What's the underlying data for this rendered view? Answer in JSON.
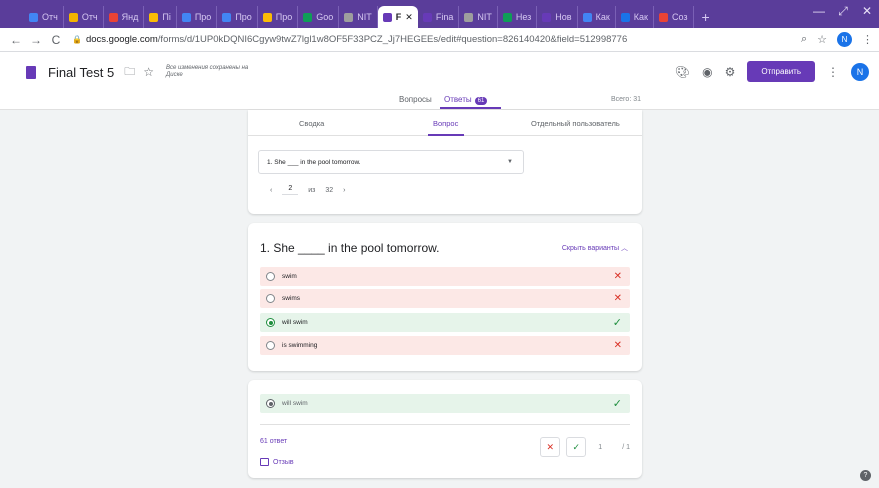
{
  "browser": {
    "tabs": [
      {
        "label": "Отч",
        "color": "#4285f4"
      },
      {
        "label": "Отч",
        "color": "#f4b400"
      },
      {
        "label": "Янд",
        "color": "#ea4335"
      },
      {
        "label": "Пі",
        "color": "#fbbc05"
      },
      {
        "label": "Про",
        "color": "#4285f4"
      },
      {
        "label": "Про",
        "color": "#4285f4"
      },
      {
        "label": "Про",
        "color": "#fbbc05"
      },
      {
        "label": "Goo",
        "color": "#0f9d58"
      },
      {
        "label": "NIT",
        "color": "#9e9e9e"
      },
      {
        "label": "F",
        "color": "#673ab7",
        "active": true
      },
      {
        "label": "Fina",
        "color": "#673ab7"
      },
      {
        "label": "NIT",
        "color": "#9e9e9e"
      },
      {
        "label": "Нез",
        "color": "#0f9d58"
      },
      {
        "label": "Нов",
        "color": "#673ab7"
      },
      {
        "label": "Как",
        "color": "#4285f4"
      },
      {
        "label": "Как",
        "color": "#1a73e8"
      },
      {
        "label": "Соз",
        "color": "#ea4335"
      }
    ],
    "new_tab": "+",
    "url_host": "docs.google.com",
    "url_path": "/forms/d/1UP0kDQNI6Cgyw9twZ7lgl1w8OF5F33PCZ_Jj7HEGEEs/edit#question=826140420&field=512998776",
    "profile_initial": "N"
  },
  "header": {
    "title": "Final Test 5",
    "saved_text": "Все изменения сохранены на Диске",
    "send_label": "Отправить",
    "avatar_initial": "N"
  },
  "subtabs": {
    "questions": "Вопросы",
    "answers": "Ответы",
    "answers_count": "61",
    "total": "Всего: 31"
  },
  "view_tabs": {
    "summary": "Сводка",
    "question": "Вопрос",
    "individual": "Отдельный пользователь"
  },
  "selector": {
    "question_text": "1. She ___ in the pool tomorrow.",
    "page_current": "2",
    "page_sep": "из",
    "page_total": "32"
  },
  "question": {
    "title": "1. She ____ in the pool tomorrow.",
    "hide_label": "Скрыть варианты",
    "options": [
      {
        "label": "swim",
        "correct": false
      },
      {
        "label": "swims",
        "correct": false
      },
      {
        "label": "will swim",
        "correct": true
      },
      {
        "label": "is swimming",
        "correct": false
      }
    ]
  },
  "response": {
    "answer": "will swim",
    "count_label": "61 ответ",
    "feedback_label": "Отзыв",
    "score": "1",
    "score_total": "/ 1"
  }
}
